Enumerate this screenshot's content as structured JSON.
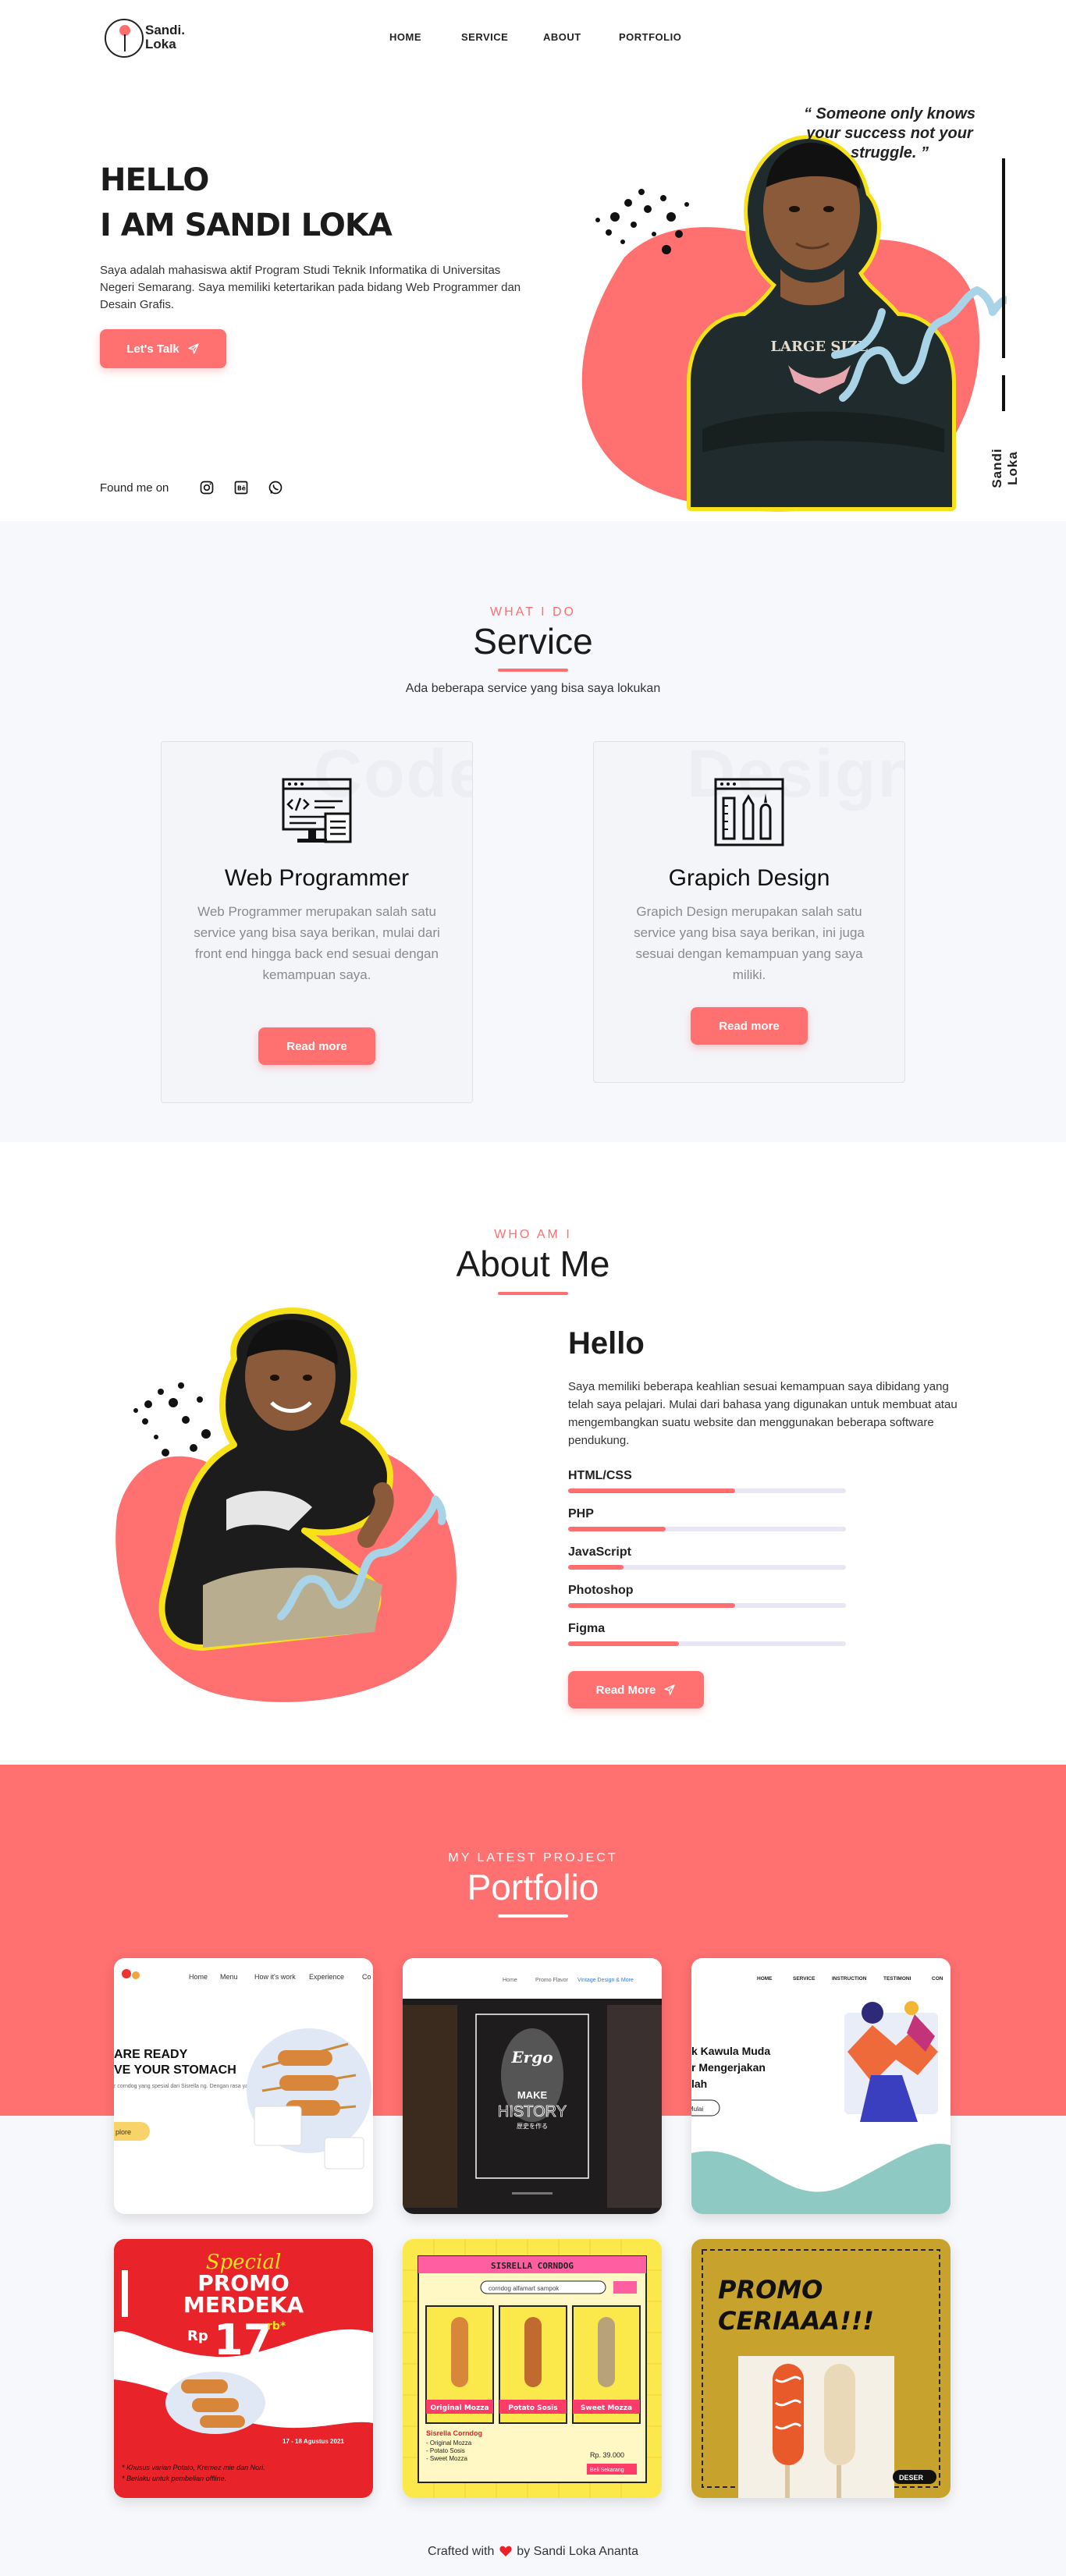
{
  "brand": {
    "line1": "Sandi.",
    "line2": "Loka"
  },
  "nav": [
    "HOME",
    "SERVICE",
    "ABOUT",
    "PORTFOLIO"
  ],
  "hero": {
    "title1": "HELLO",
    "title2": "I AM SANDI LOKA",
    "description": "Saya adalah mahasiswa aktif Program Studi Teknik Informatika di Universitas Negeri Semarang. Saya memiliki ketertarikan pada bidang Web Programmer dan Desain Grafis.",
    "cta": "Let's Talk",
    "found_me": "Found me on",
    "socials": [
      "instagram-icon",
      "behance-icon",
      "whatsapp-icon"
    ],
    "quote": "“ Someone only knows your success not your struggle. ”",
    "vertical_name": "Sandi Loka",
    "shirt_text": "LARGE SIZE"
  },
  "service": {
    "eyebrow": "WHAT I DO",
    "title": "Service",
    "subtitle": "Ada beberapa service yang bisa saya lokukan",
    "cards": [
      {
        "ghost": "Code",
        "title": "Web Programmer",
        "text": "Web Programmer merupakan salah satu service yang bisa saya berikan, mulai dari front end hingga back end sesuai dengan kemampuan saya.",
        "button": "Read more",
        "icon": "code-monitor-icon"
      },
      {
        "ghost": "Design",
        "title": "Grapich Design",
        "text": "Grapich Design merupakan salah satu service yang bisa saya berikan, ini juga sesuai dengan kemampuan yang saya miliki.",
        "button": "Read more",
        "icon": "design-tools-icon"
      }
    ]
  },
  "about": {
    "eyebrow": "WHO AM I",
    "title": "About Me",
    "heading": "Hello",
    "text": "Saya memiliki beberapa keahlian sesuai kemampuan saya dibidang yang telah saya pelajari. Mulai dari bahasa yang digunakan untuk membuat atau mengembangkan suatu website dan menggunakan beberapa software pendukung.",
    "skills": [
      {
        "name": "HTML/CSS",
        "level": 0.6
      },
      {
        "name": "PHP",
        "level": 0.35
      },
      {
        "name": "JavaScript",
        "level": 0.2
      },
      {
        "name": "Photoshop",
        "level": 0.6
      },
      {
        "name": "Figma",
        "level": 0.4
      }
    ],
    "button": "Read More"
  },
  "portfolio": {
    "eyebrow": "MY LATEST PROJECT",
    "title": "Portfolio",
    "p1": {
      "nav": [
        "Home",
        "Menu",
        "How it's work",
        "Experience",
        "Co"
      ],
      "h1": "ARE READY",
      "h2": "VE YOUR STOMACH",
      "small": "r corndog yang spesial dari Sisrella ng. Dengan rasa yang mulai di",
      "btn": "plore"
    },
    "p2": {
      "nav": [
        "Home",
        "Promo Flavor",
        "Vintage Design & More"
      ],
      "brand": "Ergo",
      "l1": "MAKE",
      "l2": "HISTORY",
      "l3": "歴史を作る"
    },
    "p3": {
      "nav": [
        "HOME",
        "SERVICE",
        "INSTRUCTION",
        "TESTIMONI",
        "CON"
      ],
      "l1": "k Kawula Muda",
      "l2": "r Mengerjakan",
      "l3": "lah",
      "btn": "Mulai"
    },
    "p4": {
      "script": "Special",
      "promo": "PROMO",
      "merdeka": "MERDEKA",
      "rp": "Rp",
      "price": "17",
      "rb": "rb*",
      "date": "17 - 18 Agustus 2021",
      "note1": "* Khusus varian Potato, Kremez mie dan Nori.",
      "note2": "* Berlaku untuk pembelian offline."
    },
    "p5": {
      "title": "SISRELLA CORNDOG",
      "search": "corndog alfamart sampok",
      "items": [
        "Original Mozza",
        "Potato Sosis",
        "Sweet Mozza"
      ],
      "name": "Sisrella Corndog",
      "list": [
        "- Original Mozza",
        "- Potato Sosis",
        "- Sweet Mozza"
      ],
      "price": "Rp. 39.000",
      "btn": "Beli Sekarang"
    },
    "p6": {
      "l1": "PROMO",
      "l2": "CERIAAA!!!",
      "tag": "DESER"
    }
  },
  "footer": {
    "before": "Crafted with",
    "after": "by Sandi Loka Ananta"
  },
  "colors": {
    "accent": "#ff7070",
    "dark": "#1b1b1b",
    "highlight": "#f7e21a",
    "squiggle": "#a9d3e6"
  }
}
